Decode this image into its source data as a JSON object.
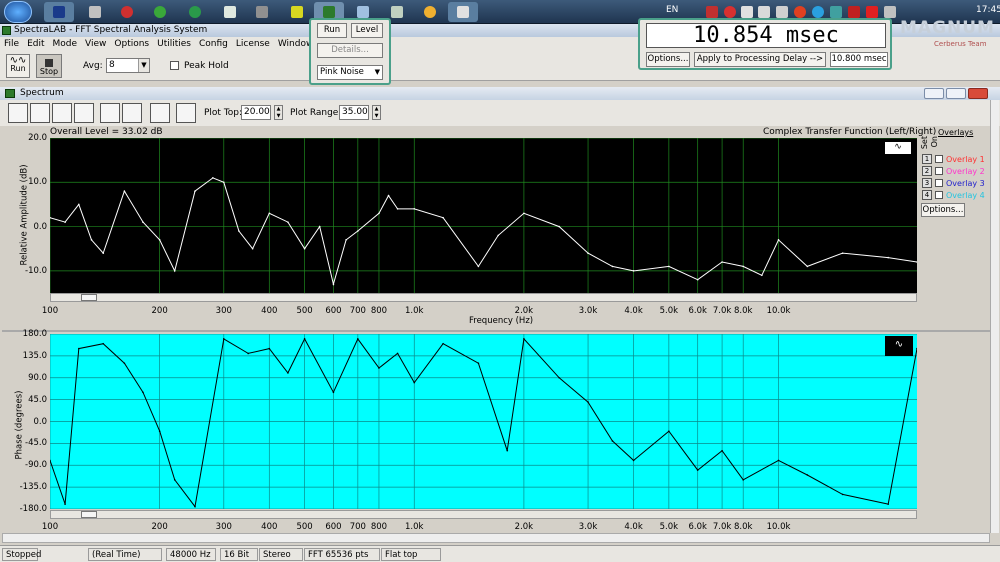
{
  "taskbar": {
    "lang": "EN",
    "clock": "17:45"
  },
  "window": {
    "title": "SpectraLAB - FFT Spectral Analysis System"
  },
  "menu": [
    "File",
    "Edit",
    "Mode",
    "View",
    "Options",
    "Utilities",
    "Config",
    "License",
    "Window"
  ],
  "toolbar": {
    "run_label": "Run",
    "stop_label": "Stop",
    "avg_label": "Avg:",
    "avg_value": "8",
    "peak_hold_label": "Peak Hold"
  },
  "generator_popup": {
    "run_label": "Run",
    "level_label": "Level",
    "details_label": "Details...",
    "noise_select": "Pink Noise"
  },
  "delay_popup": {
    "value": "10.854 msec",
    "options_label": "Options...",
    "apply_label": "Apply to Processing Delay -->",
    "apply_value": "10.800 msec"
  },
  "watermark": {
    "brand": "MAGNUM",
    "team": "Cerberus Team"
  },
  "spectrum": {
    "window_title": "Spectrum",
    "plot_top_label": "Plot Top:",
    "plot_top_value": "20.00",
    "plot_range_label": "Plot Range:",
    "plot_range_value": "35.00",
    "overall_level": "Overall Level = 33.02 dB",
    "transfer_title": "Complex Transfer Function (Left/Right)",
    "amp_ylabel": "Relative Amplitude (dB)",
    "phase_ylabel": "Phase (degrees)",
    "xlabel": "Frequency (Hz)",
    "overlays": {
      "title": "Overlays",
      "set_label": "Set",
      "on_label": "On",
      "items": [
        {
          "num": "1",
          "label": "Overlay 1",
          "color": "#ff3030"
        },
        {
          "num": "2",
          "label": "Overlay 2",
          "color": "#ff33cc"
        },
        {
          "num": "3",
          "label": "Overlay 3",
          "color": "#2222cc"
        },
        {
          "num": "4",
          "label": "Overlay 4",
          "color": "#22c4e0"
        }
      ],
      "options_label": "Options..."
    }
  },
  "status": {
    "mode": "Stopped",
    "time_mode": "(Real Time)",
    "rate": "48000 Hz",
    "bits": "16 Bit",
    "channels": "Stereo",
    "fft": "FFT 65536 pts",
    "window": "Flat top"
  },
  "chart_data": [
    {
      "type": "line",
      "title": "",
      "xlabel": "Frequency (Hz)",
      "ylabel": "Relative Amplitude (dB)",
      "xscale": "log",
      "xlim": [
        100,
        24000
      ],
      "ylim": [
        -15,
        20
      ],
      "xticks": [
        "100",
        "200",
        "300",
        "400",
        "500",
        "600",
        "700",
        "800",
        "1.0k",
        "2.0k",
        "3.0k",
        "4.0k",
        "5.0k",
        "6.0k",
        "7.0k",
        "8.0k",
        "10.0k"
      ],
      "yticks": [
        "20.0",
        "10.0",
        "0.0",
        "-10.0"
      ],
      "grid": true,
      "series": [
        {
          "color": "#ffffff",
          "x": [
            100,
            110,
            120,
            130,
            140,
            160,
            180,
            200,
            220,
            250,
            280,
            300,
            330,
            360,
            400,
            450,
            500,
            550,
            600,
            650,
            700,
            800,
            850,
            900,
            1000,
            1200,
            1500,
            1700,
            2000,
            2500,
            3000,
            3500,
            4000,
            5000,
            6000,
            7000,
            8000,
            9000,
            10000,
            12000,
            15000,
            20000,
            24000
          ],
          "values": [
            2,
            1,
            5,
            -3,
            -6,
            8,
            1,
            -3,
            -10,
            8,
            11,
            10,
            -1,
            -5,
            3,
            1,
            -5,
            0,
            -13,
            -3,
            -1,
            3,
            7,
            4,
            4,
            2,
            -9,
            -2,
            3,
            0,
            -6,
            -9,
            -10,
            -9,
            -12,
            -8,
            -9,
            -11,
            -3,
            -9,
            -6,
            -7,
            -8
          ]
        }
      ]
    },
    {
      "type": "line",
      "title": "",
      "xlabel": "",
      "ylabel": "Phase (degrees)",
      "xscale": "log",
      "xlim": [
        100,
        24000
      ],
      "ylim": [
        -180,
        180
      ],
      "xticks": [
        "100",
        "200",
        "300",
        "400",
        "500",
        "600",
        "700",
        "800",
        "1.0k",
        "2.0k",
        "3.0k",
        "4.0k",
        "5.0k",
        "6.0k",
        "7.0k",
        "8.0k",
        "10.0k"
      ],
      "yticks": [
        "180.0",
        "135.0",
        "90.0",
        "45.0",
        "0.0",
        "-45.0",
        "-90.0",
        "-135.0",
        "-180.0"
      ],
      "grid": true,
      "series": [
        {
          "color": "#000000",
          "x": [
            100,
            110,
            120,
            140,
            160,
            180,
            200,
            220,
            250,
            300,
            350,
            400,
            450,
            500,
            600,
            700,
            800,
            900,
            1000,
            1200,
            1500,
            1800,
            2000,
            2500,
            3000,
            3500,
            4000,
            5000,
            6000,
            7000,
            8000,
            10000,
            12000,
            15000,
            20000,
            24000
          ],
          "values": [
            -80,
            -170,
            150,
            160,
            120,
            60,
            -20,
            -120,
            -175,
            170,
            140,
            150,
            100,
            170,
            60,
            170,
            110,
            140,
            80,
            160,
            120,
            -60,
            170,
            90,
            40,
            -40,
            -80,
            -20,
            -100,
            -60,
            -120,
            -80,
            -110,
            -150,
            -170,
            150
          ]
        }
      ]
    }
  ]
}
